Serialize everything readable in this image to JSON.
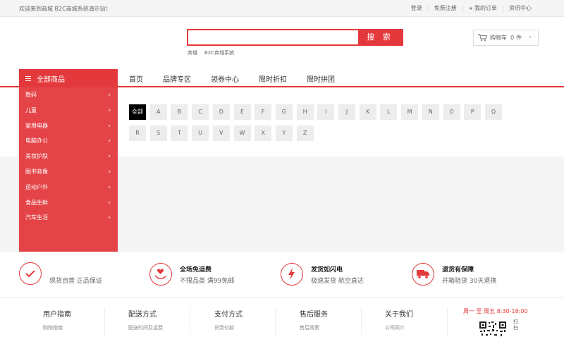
{
  "topbar": {
    "welcome": "欢迎来到商城 B2C商城系统演示站！",
    "links": [
      "登录",
      "免费注册",
      "我的订单",
      "资讯中心"
    ]
  },
  "search": {
    "value": "",
    "placeholder": "",
    "button": "搜 索",
    "hotwords": [
      "商城",
      "B2C商城系统"
    ]
  },
  "cart": {
    "label": "购物车",
    "count": "0",
    "unit": "件"
  },
  "nav": {
    "all_categories": "全部商品",
    "items": [
      "首页",
      "品牌专区",
      "领券中心",
      "限时折扣",
      "限时拼团"
    ]
  },
  "sidebar": {
    "categories": [
      "数码",
      "儿童",
      "家用电器",
      "电脑办公",
      "美妆护肤",
      "图书音像",
      "运动户外",
      "食品生鲜",
      "汽车生活"
    ]
  },
  "brand_letters": [
    "全部",
    "A",
    "B",
    "C",
    "D",
    "E",
    "F",
    "G",
    "H",
    "I",
    "J",
    "K",
    "L",
    "M",
    "N",
    "O",
    "P",
    "Q",
    "R",
    "S",
    "T",
    "U",
    "V",
    "W",
    "X",
    "Y",
    "Z"
  ],
  "services": [
    {
      "title": "",
      "desc": "现货自营 正品保证",
      "icon": "shield-check-icon"
    },
    {
      "title": "全场免运费",
      "desc": "不限品类 满99免邮",
      "icon": "gift-hand-icon"
    },
    {
      "title": "发货如闪电",
      "desc": "极速发货 航空直达",
      "icon": "lightning-icon"
    },
    {
      "title": "退货有保障",
      "desc": "开箱验货 30天退换",
      "icon": "truck-icon"
    }
  ],
  "footer": {
    "columns": [
      {
        "heading": "用户指南",
        "first_link": "购物指南"
      },
      {
        "heading": "配送方式",
        "first_link": "配送时间及运费"
      },
      {
        "heading": "支付方式",
        "first_link": "货到付款"
      },
      {
        "heading": "售后服务",
        "first_link": "售后政策"
      },
      {
        "heading": "关于我们",
        "first_link": "公司简介"
      }
    ],
    "hours": "周一 至 周五   8:30-18:00",
    "scan": "扫扫"
  },
  "colors": {
    "accent": "#e4393c",
    "sidebar": "#e44448",
    "gray_bg": "#f5f5f5"
  }
}
